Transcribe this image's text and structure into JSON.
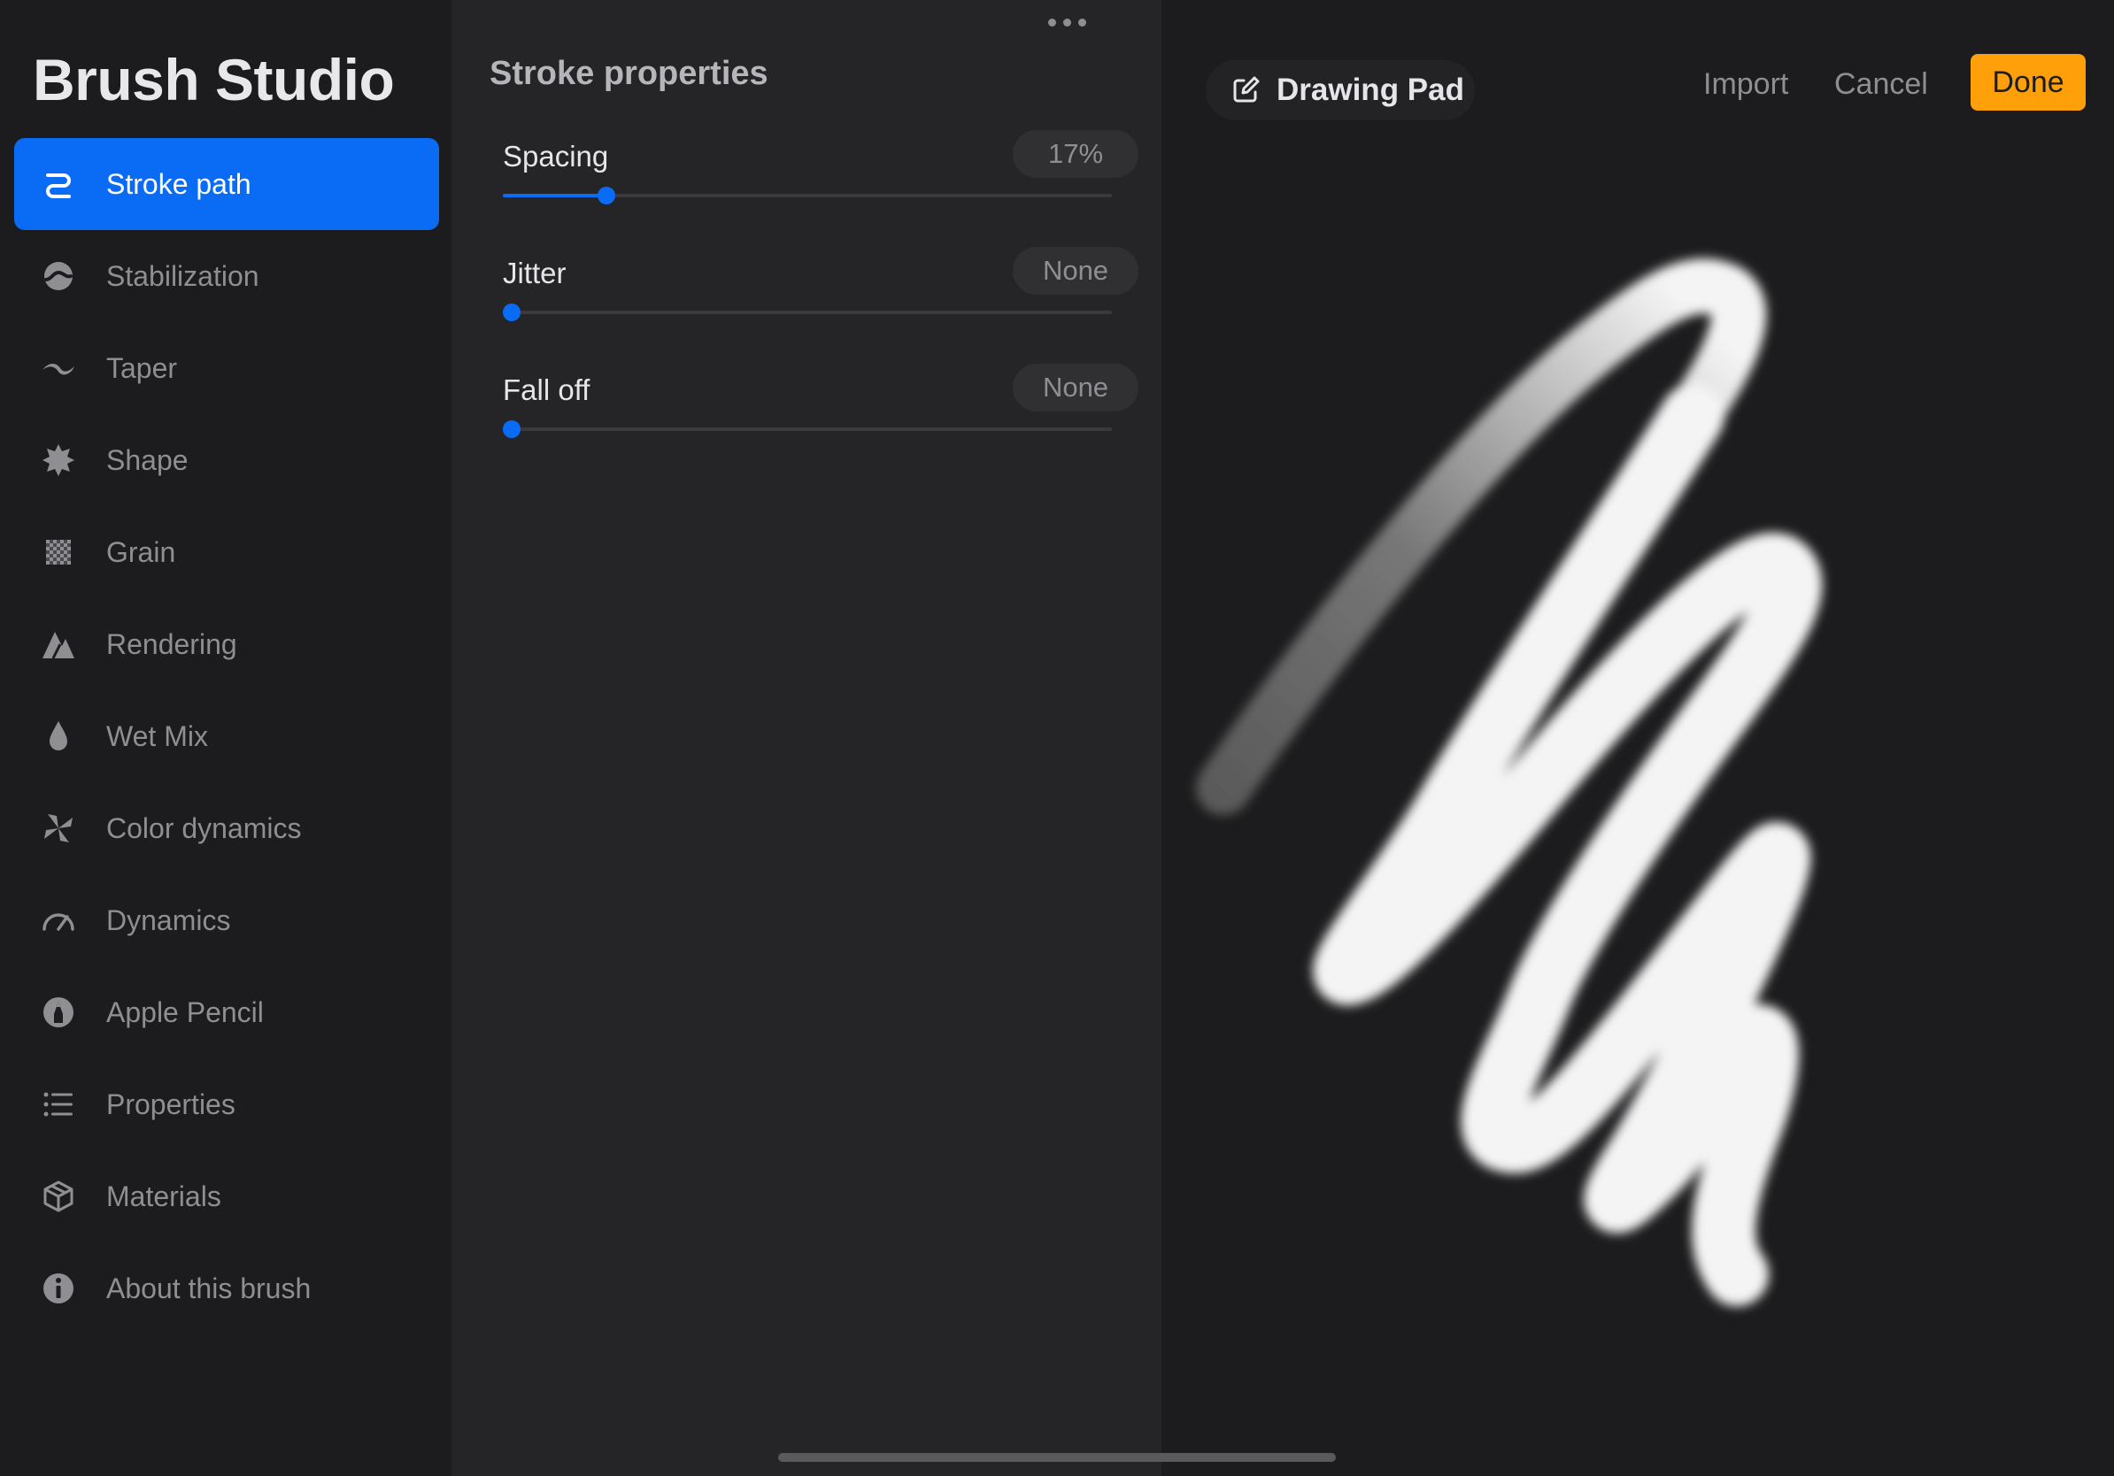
{
  "sidebar": {
    "title": "Brush Studio",
    "items": [
      {
        "label": "Stroke path",
        "icon": "stroke-path-icon",
        "active": true
      },
      {
        "label": "Stabilization",
        "icon": "stabilization-icon"
      },
      {
        "label": "Taper",
        "icon": "taper-icon"
      },
      {
        "label": "Shape",
        "icon": "shape-icon"
      },
      {
        "label": "Grain",
        "icon": "grain-icon"
      },
      {
        "label": "Rendering",
        "icon": "rendering-icon"
      },
      {
        "label": "Wet Mix",
        "icon": "wet-mix-icon"
      },
      {
        "label": "Color dynamics",
        "icon": "color-dynamics-icon"
      },
      {
        "label": "Dynamics",
        "icon": "dynamics-icon"
      },
      {
        "label": "Apple Pencil",
        "icon": "apple-pencil-icon"
      },
      {
        "label": "Properties",
        "icon": "properties-icon"
      },
      {
        "label": "Materials",
        "icon": "materials-icon"
      },
      {
        "label": "About this brush",
        "icon": "info-icon"
      }
    ]
  },
  "panel": {
    "title": "Stroke properties",
    "properties": [
      {
        "label": "Spacing",
        "value": "17%",
        "level": 0.17
      },
      {
        "label": "Jitter",
        "value": "None",
        "level": 0
      },
      {
        "label": "Fall off",
        "value": "None",
        "level": 0
      }
    ]
  },
  "pad": {
    "title": "Drawing Pad",
    "import_label": "Import",
    "cancel_label": "Cancel",
    "done_label": "Done"
  },
  "colors": {
    "accent": "#0a6cf5",
    "done": "#ff9f0a",
    "background": "#1c1c1e",
    "panel": "#252527"
  }
}
